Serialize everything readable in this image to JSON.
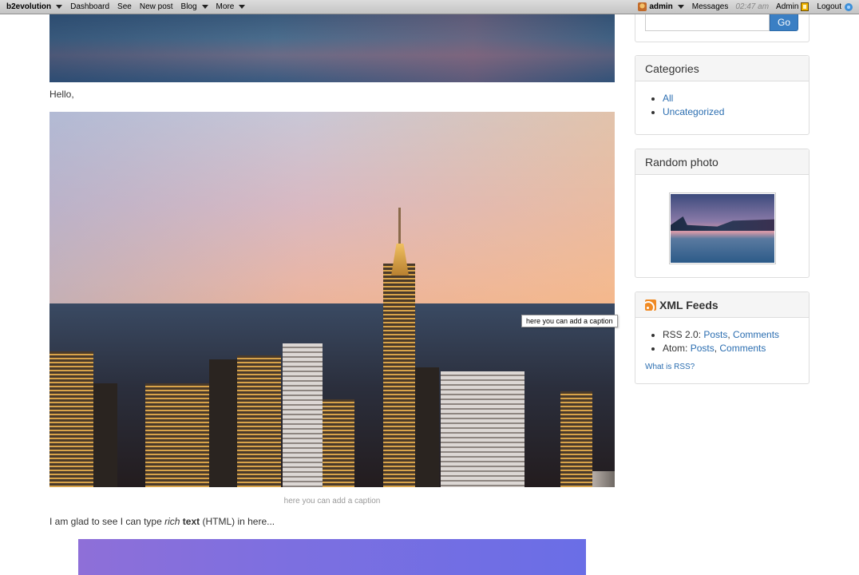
{
  "topbar": {
    "brand": "b2evolution",
    "menu": [
      "Dashboard",
      "See",
      "New post",
      "Blog",
      "More"
    ],
    "user": "admin",
    "messages": "Messages",
    "time": "02:47 am",
    "admin": "Admin",
    "logout": "Logout"
  },
  "post": {
    "hello": "Hello,",
    "tooltip": "here you can add a caption",
    "caption": "here you can add a caption",
    "rich_prefix": "I am glad to see I can type ",
    "rich_em": "rich",
    "rich_strong": "text",
    "rich_suffix": " (HTML) in here..."
  },
  "sidebar": {
    "search_button": "Go",
    "categories_title": "Categories",
    "categories": [
      "All",
      "Uncategorized"
    ],
    "random_photo_title": "Random photo",
    "feeds_title": "XML Feeds",
    "rss_label": "RSS 2.0: ",
    "atom_label": "Atom: ",
    "posts": "Posts",
    "comments": "Comments",
    "separator": ", ",
    "what_is_rss": "What is RSS?"
  },
  "colors": {
    "link": "#2a6db0",
    "button": "#3a7fc4",
    "rss": "#f08a24"
  }
}
